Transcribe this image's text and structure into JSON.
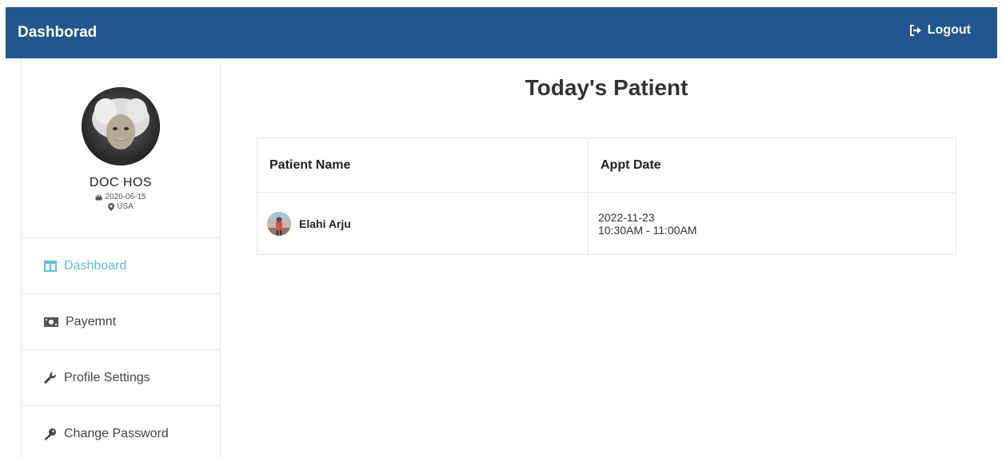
{
  "navbar": {
    "brand": "Dashborad",
    "logout_label": "Logout"
  },
  "profile": {
    "name": "DOC HOS",
    "date": "2020-06-15",
    "location": "USA"
  },
  "sidebar": {
    "items": [
      {
        "label": "Dashboard",
        "icon": "columns-icon",
        "active": true
      },
      {
        "label": "Payemnt",
        "icon": "money-icon",
        "active": false
      },
      {
        "label": "Profile Settings",
        "icon": "wrench-icon",
        "active": false
      },
      {
        "label": "Change Password",
        "icon": "key-icon",
        "active": false
      }
    ]
  },
  "main": {
    "title": "Today's Patient",
    "table": {
      "headers": [
        "Patient Name",
        "Appt Date"
      ],
      "rows": [
        {
          "patient": "Elahi Arju",
          "date": "2022-11-23",
          "time": "10:30AM - 11:00AM"
        }
      ]
    }
  },
  "colors": {
    "navbar": "#22568e",
    "active": "#5bc0de"
  }
}
